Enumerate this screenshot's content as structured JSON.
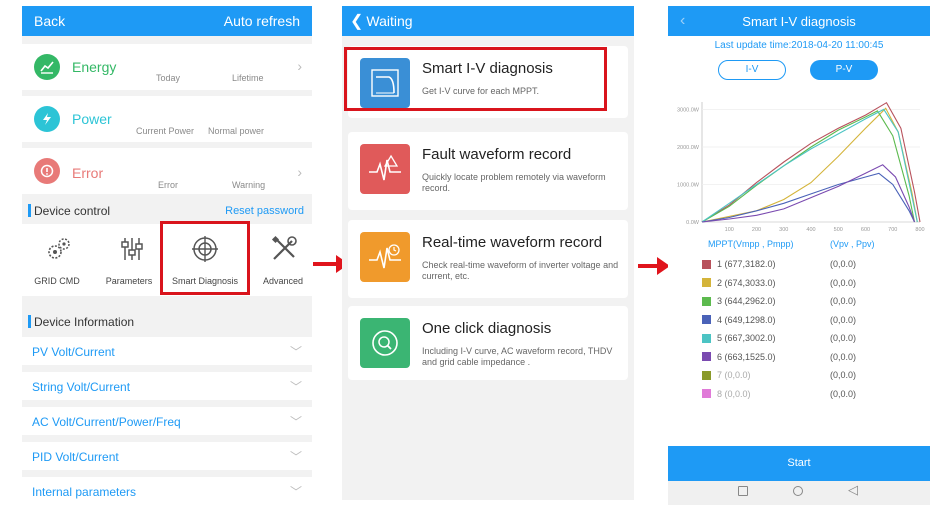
{
  "screen1": {
    "back_label": "Back",
    "auto_refresh_label": "Auto refresh",
    "energy": {
      "label": "Energy",
      "today": "Today",
      "lifetime": "Lifetime"
    },
    "power": {
      "label": "Power",
      "current": "Current Power",
      "normal": "Normal power"
    },
    "error": {
      "label": "Error",
      "error_col": "Error",
      "warning_col": "Warning"
    },
    "device_control": {
      "title": "Device control",
      "reset_password": "Reset password"
    },
    "controls": [
      {
        "label": "GRID CMD",
        "icon": "gears-icon"
      },
      {
        "label": "Parameters",
        "icon": "sliders-icon"
      },
      {
        "label": "Smart Diagnosis",
        "icon": "crosshair-icon"
      },
      {
        "label": "Advanced",
        "icon": "tools-icon"
      }
    ],
    "device_info": {
      "title": "Device Information"
    },
    "info_rows": [
      "PV Volt/Current",
      "String Volt/Current",
      "AC Volt/Current/Power/Freq",
      "PID Volt/Current",
      "Internal parameters"
    ],
    "colors": {
      "accent": "#1e9af5",
      "energy": "#34b866",
      "power": "#2cc4d6",
      "error": "#e87a78"
    }
  },
  "screen2": {
    "back_label": "Waiting",
    "items": [
      {
        "title": "Smart I-V diagnosis",
        "desc": "Get I-V curve for each MPPT.",
        "icon": "iv-curve-icon",
        "color": "#3a8fd6"
      },
      {
        "title": "Fault waveform record",
        "desc": "Quickly locate problem remotely via waveform record.",
        "icon": "fault-waveform-icon",
        "color": "#e05a5a"
      },
      {
        "title": "Real-time waveform record",
        "desc": "Check real-time waveform of inverter voltage and current, etc.",
        "icon": "realtime-waveform-icon",
        "color": "#f09a2c"
      },
      {
        "title": "One click diagnosis",
        "desc": "Including I-V curve, AC waveform record, THDV and grid cable impedance .",
        "icon": "one-click-diagnosis-icon",
        "color": "#3bb573"
      }
    ]
  },
  "screen3": {
    "title": "Smart I-V diagnosis",
    "last_update": "Last update time:2018-04-20 11:00:45",
    "tab_iv": "I-V",
    "tab_pv": "P-V",
    "header_mppt": "MPPT(Vmpp , Pmpp)",
    "header_vp": "(Vpv , Ppv)",
    "legend": [
      {
        "label": "1  (677,3182.0)",
        "ppv": "(0,0.0)",
        "color": "#b8525c"
      },
      {
        "label": "2  (674,3033.0)",
        "ppv": "(0,0.0)",
        "color": "#d4b43a"
      },
      {
        "label": "3  (644,2962.0)",
        "ppv": "(0,0.0)",
        "color": "#5cba4e"
      },
      {
        "label": "4  (649,1298.0)",
        "ppv": "(0,0.0)",
        "color": "#4a62b8"
      },
      {
        "label": "5  (667,3002.0)",
        "ppv": "(0,0.0)",
        "color": "#4cc4c4"
      },
      {
        "label": "6  (663,1525.0)",
        "ppv": "(0,0.0)",
        "color": "#7a4ab0"
      },
      {
        "label": "7  (0,0.0)",
        "ppv": "(0,0.0)",
        "color": "#8a9a2a"
      },
      {
        "label": "8  (0,0.0)",
        "ppv": "(0,0.0)",
        "color": "#e07ad8"
      }
    ],
    "start_label": "Start"
  },
  "chart_data": {
    "type": "line",
    "title": "",
    "xlabel": "",
    "ylabel": "",
    "xlim": [
      0,
      800
    ],
    "ylim": [
      0,
      3200
    ],
    "x_ticks": [
      "100",
      "200",
      "300",
      "400",
      "500",
      "600",
      "700",
      "800"
    ],
    "y_ticks": [
      "0.0W",
      "1000.0W",
      "2000.0W",
      "3000.0W"
    ],
    "series": [
      {
        "name": "1",
        "color": "#b8525c",
        "points": [
          [
            0,
            0
          ],
          [
            100,
            450
          ],
          [
            200,
            1050
          ],
          [
            300,
            1600
          ],
          [
            400,
            2100
          ],
          [
            500,
            2500
          ],
          [
            600,
            2850
          ],
          [
            677,
            3182
          ],
          [
            730,
            2500
          ],
          [
            780,
            800
          ],
          [
            800,
            0
          ]
        ]
      },
      {
        "name": "2",
        "color": "#d4b43a",
        "points": [
          [
            0,
            0
          ],
          [
            200,
            300
          ],
          [
            300,
            600
          ],
          [
            400,
            1050
          ],
          [
            500,
            1750
          ],
          [
            600,
            2500
          ],
          [
            674,
            3033
          ],
          [
            720,
            2400
          ],
          [
            770,
            800
          ],
          [
            790,
            0
          ]
        ]
      },
      {
        "name": "3",
        "color": "#5cba4e",
        "points": [
          [
            0,
            0
          ],
          [
            100,
            420
          ],
          [
            200,
            980
          ],
          [
            300,
            1500
          ],
          [
            400,
            2000
          ],
          [
            500,
            2450
          ],
          [
            600,
            2800
          ],
          [
            644,
            2962
          ],
          [
            700,
            2300
          ],
          [
            760,
            700
          ],
          [
            780,
            0
          ]
        ]
      },
      {
        "name": "4",
        "color": "#4a62b8",
        "points": [
          [
            0,
            0
          ],
          [
            100,
            120
          ],
          [
            200,
            300
          ],
          [
            300,
            500
          ],
          [
            400,
            750
          ],
          [
            500,
            1000
          ],
          [
            600,
            1200
          ],
          [
            649,
            1298
          ],
          [
            700,
            1000
          ],
          [
            760,
            300
          ],
          [
            780,
            0
          ]
        ]
      },
      {
        "name": "5",
        "color": "#4cc4c4",
        "points": [
          [
            0,
            0
          ],
          [
            100,
            500
          ],
          [
            200,
            1000
          ],
          [
            300,
            1500
          ],
          [
            400,
            1950
          ],
          [
            500,
            2350
          ],
          [
            600,
            2750
          ],
          [
            667,
            3002
          ],
          [
            720,
            2400
          ],
          [
            770,
            700
          ],
          [
            790,
            0
          ]
        ]
      },
      {
        "name": "6",
        "color": "#7a4ab0",
        "points": [
          [
            0,
            0
          ],
          [
            100,
            80
          ],
          [
            200,
            180
          ],
          [
            300,
            350
          ],
          [
            400,
            650
          ],
          [
            500,
            950
          ],
          [
            600,
            1300
          ],
          [
            663,
            1525
          ],
          [
            710,
            1200
          ],
          [
            760,
            400
          ],
          [
            780,
            0
          ]
        ]
      }
    ]
  }
}
